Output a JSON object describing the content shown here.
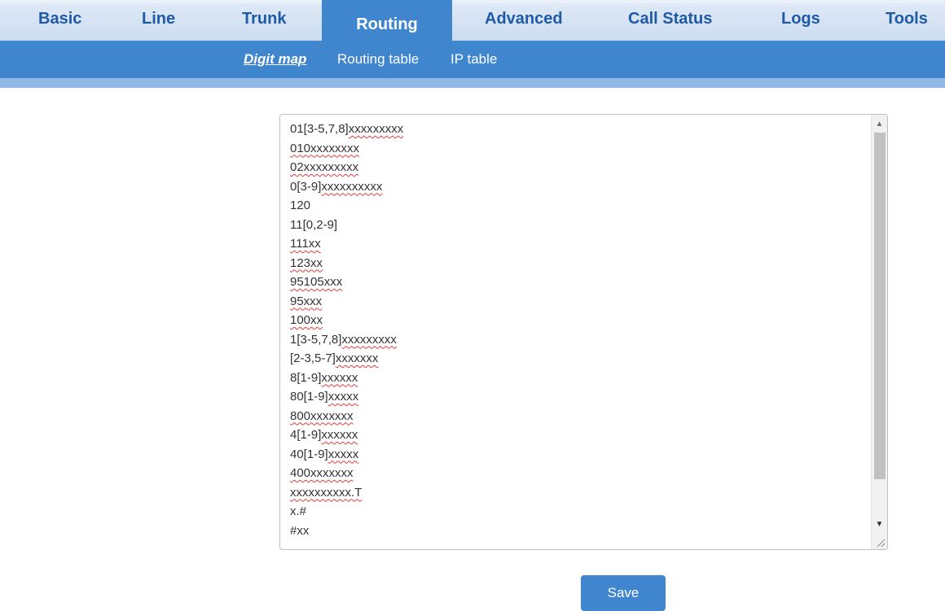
{
  "nav": {
    "tabs": [
      {
        "label": "Basic"
      },
      {
        "label": "Line"
      },
      {
        "label": "Trunk"
      },
      {
        "label": "Routing"
      },
      {
        "label": "Advanced"
      },
      {
        "label": "Call Status"
      },
      {
        "label": "Logs"
      },
      {
        "label": "Tools"
      }
    ],
    "active": "Routing"
  },
  "subnav": {
    "items": [
      {
        "label": "Digit map"
      },
      {
        "label": "Routing table"
      },
      {
        "label": "IP table"
      }
    ],
    "active": "Digit map"
  },
  "digitmap": {
    "lines": [
      {
        "pre": "01[3-5,7,8]",
        "sq": "xxxxxxxxx"
      },
      {
        "pre": "",
        "sq": "010xxxxxxxx"
      },
      {
        "pre": "",
        "sq": "02xxxxxxxxx"
      },
      {
        "pre": "0[3-9]",
        "sq": "xxxxxxxxxx"
      },
      {
        "pre": "120",
        "sq": ""
      },
      {
        "pre": "11[0,2-9]",
        "sq": ""
      },
      {
        "pre": "",
        "sq": "111xx"
      },
      {
        "pre": "",
        "sq": "123xx"
      },
      {
        "pre": "",
        "sq": "95105xxx"
      },
      {
        "pre": "",
        "sq": "95xxx"
      },
      {
        "pre": "",
        "sq": "100xx"
      },
      {
        "pre": "1[3-5,7,8]",
        "sq": "xxxxxxxxx"
      },
      {
        "pre": "[2-3,5-7]",
        "sq": "xxxxxxx"
      },
      {
        "pre": "8[1-9]",
        "sq": "xxxxxx"
      },
      {
        "pre": "80[1-9]",
        "sq": "xxxxx"
      },
      {
        "pre": "",
        "sq": "800xxxxxxx"
      },
      {
        "pre": "4[1-9]",
        "sq": "xxxxxx"
      },
      {
        "pre": "40[1-9]",
        "sq": "xxxxx"
      },
      {
        "pre": "",
        "sq": "400xxxxxxx"
      },
      {
        "pre": "",
        "sq": "xxxxxxxxxx.T"
      },
      {
        "pre": "x.#",
        "sq": ""
      },
      {
        "pre": "#xx",
        "sq": ""
      }
    ]
  },
  "save_label": "Save",
  "colors": {
    "primary": "#3f86cf",
    "nav_text": "#1f5aa6",
    "strip": "#8fb8e6"
  }
}
